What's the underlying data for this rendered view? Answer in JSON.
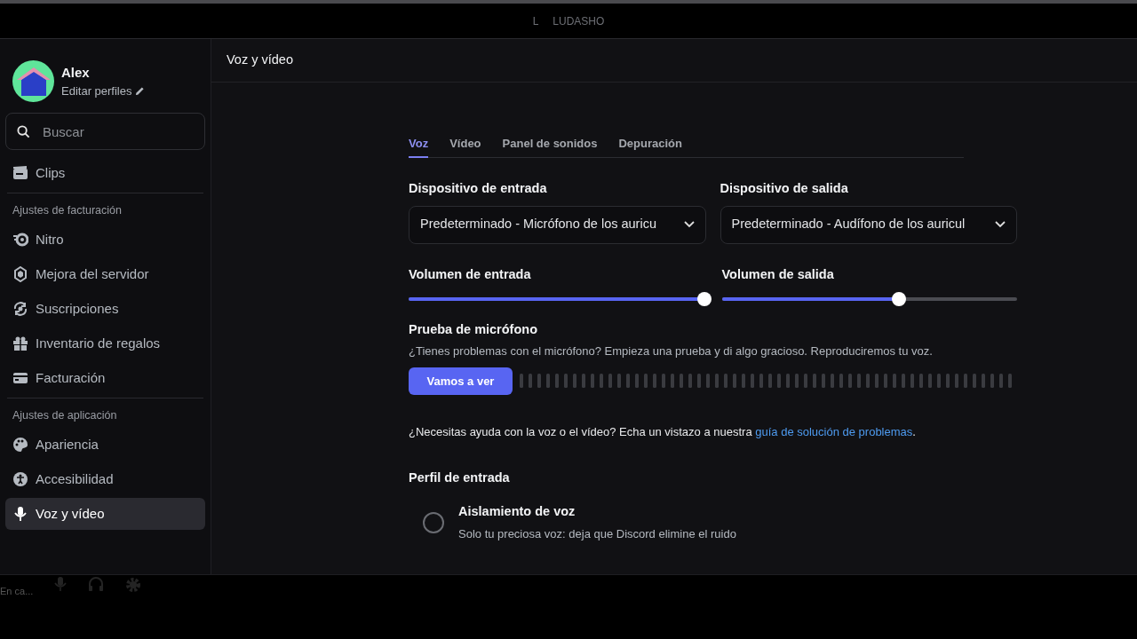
{
  "title_bar": {
    "server_initial": "L",
    "title": "LUDASHO"
  },
  "profile": {
    "name": "Alex",
    "edit_label": "Editar perfiles"
  },
  "search": {
    "placeholder": "Buscar"
  },
  "sidebar": {
    "sections": [
      {
        "items": [
          {
            "label": "Clips",
            "selected": false
          }
        ]
      },
      {
        "title": "Ajustes de facturación",
        "items": [
          {
            "label": "Nitro",
            "selected": false
          },
          {
            "label": "Mejora del servidor",
            "selected": false
          },
          {
            "label": "Suscripciones",
            "selected": false
          },
          {
            "label": "Inventario de regalos",
            "selected": false
          },
          {
            "label": "Facturación",
            "selected": false
          }
        ]
      },
      {
        "title": "Ajustes de aplicación",
        "items": [
          {
            "label": "Apariencia",
            "selected": false
          },
          {
            "label": "Accesibilidad",
            "selected": false
          },
          {
            "label": "Voz y vídeo",
            "selected": true
          }
        ]
      }
    ]
  },
  "user_status": {
    "text": "En ca..."
  },
  "page_title": "Voz y vídeo",
  "tabs": [
    {
      "label": "Voz",
      "selected": true
    },
    {
      "label": "Vídeo",
      "selected": false
    },
    {
      "label": "Panel de sonidos",
      "selected": false
    },
    {
      "label": "Depuración",
      "selected": false
    }
  ],
  "devices": [
    {
      "label": "Dispositivo de entrada",
      "value": "Predeterminado - Micrófono de los auricu"
    },
    {
      "label": "Dispositivo de salida",
      "value": "Predeterminado - Audífono de los auricul"
    }
  ],
  "volumes": [
    {
      "label": "Volumen de entrada",
      "level": 1.0
    },
    {
      "label": "Volumen de salida",
      "level": 0.6
    }
  ],
  "mic_test": {
    "title": "Prueba de micrófono",
    "description": "¿Tienes problemas con el micrófono? Empieza una prueba y di algo gracioso. Reproduciremos tu voz.",
    "button": "Vamos a ver"
  },
  "help": {
    "text": "¿Necesitas ayuda con la voz o el vídeo? Echa un vistazo a nuestra ",
    "link": "guía de solución de problemas",
    "after": "."
  },
  "input_profile": {
    "title": "Perfil de entrada",
    "options": [
      {
        "title": "Aislamiento de voz",
        "description": "Solo tu preciosa voz: deja que Discord elimine el ruido",
        "selected": false
      }
    ]
  }
}
